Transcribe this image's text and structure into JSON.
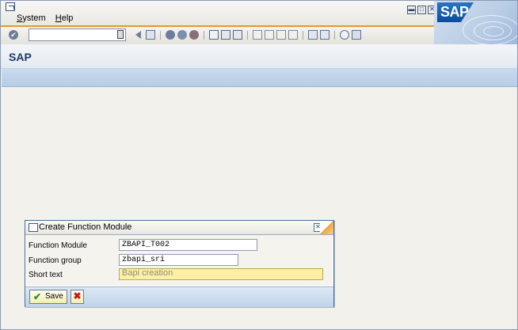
{
  "menu": {
    "items": [
      {
        "label": "System",
        "hotkey": "S"
      },
      {
        "label": "Help",
        "hotkey": "H"
      }
    ]
  },
  "logo": "SAP",
  "toolbar": {
    "command_field_value": "",
    "icons": [
      "back-icon",
      "save-icon",
      "back-nav-icon",
      "exit-icon",
      "cancel-icon",
      "print-icon",
      "find-icon",
      "find-next-icon",
      "first-page-icon",
      "previous-page-icon",
      "next-page-icon",
      "last-page-icon",
      "new-session-icon",
      "shortcut-icon",
      "help-icon",
      "layout-menu-icon"
    ]
  },
  "page": {
    "title": "SAP"
  },
  "dialog": {
    "title": "Create Function Module",
    "fields": [
      {
        "label": "Function Module",
        "value": "ZBAPI_T002"
      },
      {
        "label": "Function group",
        "value": "zbapi_sri"
      },
      {
        "label": "Short text",
        "value": "Bapi creation"
      }
    ],
    "save_label": "Save",
    "cancel_symbol": "✖"
  },
  "colors": {
    "accent_orange": "#e09b2d",
    "app_toolbar_blue": "#b7cce6",
    "required_field_yellow": "#fcf0a6",
    "sap_logo_blue": "#0a4c9a"
  }
}
